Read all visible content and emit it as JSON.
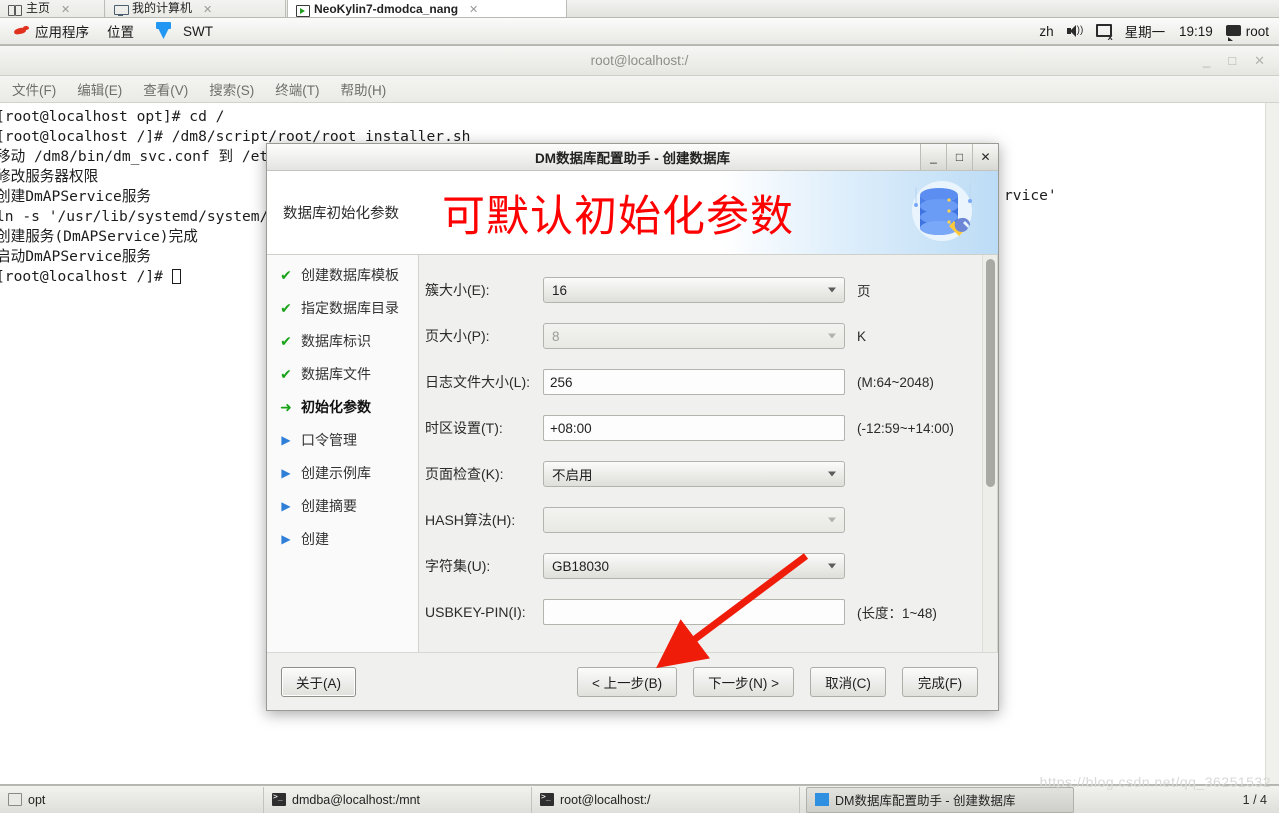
{
  "vm_tabs": [
    {
      "label": "主页",
      "icon": "home-icon",
      "active": false
    },
    {
      "label": "我的计算机",
      "icon": "computer-icon",
      "active": false
    },
    {
      "label": "NeoKylin7-dmodca_nang",
      "icon": "vm-running-icon",
      "active": true
    }
  ],
  "desktop_panel": {
    "applications_label": "应用程序",
    "places_label": "位置",
    "running_app_label": "SWT",
    "input_method": "zh",
    "day_label": "星期一",
    "clock": "19:19",
    "user": "root"
  },
  "terminal": {
    "title": "root@localhost:/",
    "menus": [
      "文件(F)",
      "编辑(E)",
      "查看(V)",
      "搜索(S)",
      "终端(T)",
      "帮助(H)"
    ],
    "lines": [
      "[root@localhost opt]# cd /",
      "[root@localhost /]# /dm8/script/root/root_installer.sh",
      "移动 /dm8/bin/dm_svc.conf 到 /etc",
      "修改服务器权限",
      "创建DmAPService服务",
      "ln -s '/usr/lib/systemd/system/DmAPService.service'",
      "创建服务(DmAPService)完成",
      "启动DmAPService服务",
      "[root@localhost /]# "
    ],
    "right_fragment": "rvice'",
    "window_buttons": [
      "_",
      "□",
      "✕"
    ]
  },
  "dialog": {
    "title": "DM数据库配置助手 - 创建数据库",
    "window_buttons": [
      "_",
      "□",
      "✕"
    ],
    "header_label": "数据库初始化参数",
    "annotation": "可默认初始化参数",
    "annotation_color": "#ff0000",
    "header_icon": "database-wrench-icon",
    "steps": [
      {
        "label": "创建数据库模板",
        "state": "done",
        "glyph": "✔"
      },
      {
        "label": "指定数据库目录",
        "state": "done",
        "glyph": "✔"
      },
      {
        "label": "数据库标识",
        "state": "done",
        "glyph": "✔"
      },
      {
        "label": "数据库文件",
        "state": "done",
        "glyph": "✔"
      },
      {
        "label": "初始化参数",
        "state": "current",
        "glyph": "➜"
      },
      {
        "label": "口令管理",
        "state": "todo",
        "glyph": "▶"
      },
      {
        "label": "创建示例库",
        "state": "todo",
        "glyph": "▶"
      },
      {
        "label": "创建摘要",
        "state": "todo",
        "glyph": "▶"
      },
      {
        "label": "创建",
        "state": "todo",
        "glyph": "▶"
      }
    ],
    "fields": [
      {
        "name": "cluster-size",
        "label": "簇大小(E):",
        "control": "select",
        "value": "16",
        "suffix": "页",
        "disabled": false
      },
      {
        "name": "page-size",
        "label": "页大小(P):",
        "control": "select",
        "value": "8",
        "suffix": "K",
        "disabled": false
      },
      {
        "name": "log-file-size",
        "label": "日志文件大小(L):",
        "control": "input",
        "value": "256",
        "suffix": "(M:64~2048)",
        "disabled": false
      },
      {
        "name": "time-zone",
        "label": "时区设置(T):",
        "control": "input",
        "value": "+08:00",
        "suffix": "(-12:59~+14:00)",
        "disabled": false
      },
      {
        "name": "page-check",
        "label": "页面检查(K):",
        "control": "select",
        "value": "不启用",
        "suffix": "",
        "disabled": false
      },
      {
        "name": "hash-algorithm",
        "label": "HASH算法(H):",
        "control": "select",
        "value": "",
        "suffix": "",
        "disabled": true
      },
      {
        "name": "charset",
        "label": "字符集(U):",
        "control": "select",
        "value": "GB18030",
        "suffix": "",
        "disabled": false
      },
      {
        "name": "usbkey-pin",
        "label": "USBKEY-PIN(I):",
        "control": "input",
        "value": "",
        "suffix": "(长度：1~48)",
        "disabled": false
      }
    ],
    "buttons": {
      "about": "关于(A)",
      "prev": "< 上一步(B)",
      "next": "下一步(N) >",
      "cancel": "取消(C)",
      "finish": "完成(F)"
    }
  },
  "taskbar": {
    "items": [
      {
        "label": "opt",
        "icon": "folder-icon",
        "active": false
      },
      {
        "label": "dmdba@localhost:/mnt",
        "icon": "terminal-icon",
        "active": false
      },
      {
        "label": "root@localhost:/",
        "icon": "terminal-icon",
        "active": false
      },
      {
        "label": "DM数据库配置助手 - 创建数据库",
        "icon": "dm-app-icon",
        "active": true
      }
    ],
    "pager": "1 / 4"
  },
  "watermark": "https://blog.csdn.net/qq_36251532"
}
